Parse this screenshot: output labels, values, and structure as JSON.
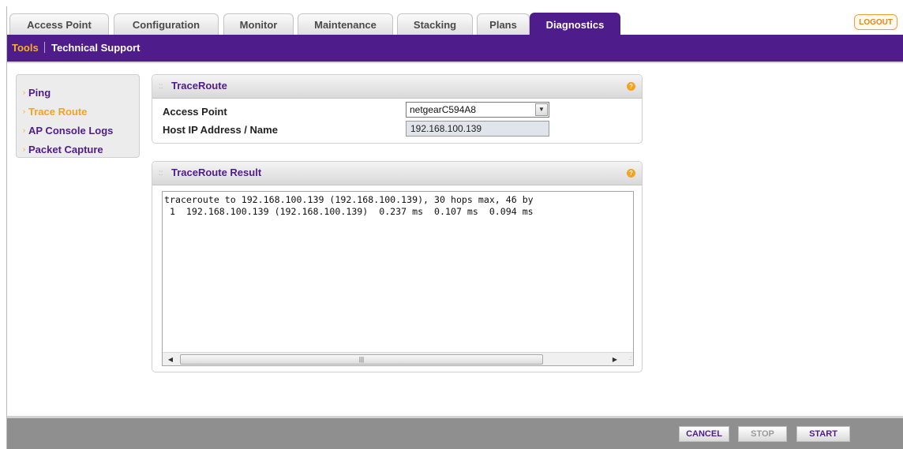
{
  "tabs": [
    {
      "label": "Access Point",
      "active": false
    },
    {
      "label": "Configuration",
      "active": false
    },
    {
      "label": "Monitor",
      "active": false
    },
    {
      "label": "Maintenance",
      "active": false
    },
    {
      "label": "Stacking",
      "active": false
    },
    {
      "label": "Plans",
      "active": false
    },
    {
      "label": "Diagnostics",
      "active": true
    }
  ],
  "logout_label": "LOGOUT",
  "subnav": {
    "items": [
      {
        "label": "Tools",
        "active": true
      },
      {
        "label": "Technical Support",
        "active": false
      }
    ]
  },
  "sidebar": {
    "items": [
      {
        "label": "Ping",
        "active": false
      },
      {
        "label": "Trace Route",
        "active": true
      },
      {
        "label": "AP Console Logs",
        "active": false
      },
      {
        "label": "Packet Capture",
        "active": false
      }
    ]
  },
  "traceroute": {
    "title": "TraceRoute",
    "access_point_label": "Access Point",
    "access_point_value": "netgearC594A8",
    "host_label": "Host IP Address / Name",
    "host_value": "192.168.100.139"
  },
  "result": {
    "title": "TraceRoute Result",
    "line1": "traceroute to 192.168.100.139 (192.168.100.139), 30 hops max, 46 by",
    "line2": " 1  192.168.100.139 (192.168.100.139)  0.237 ms  0.107 ms  0.094 ms"
  },
  "buttons": {
    "cancel": "CANCEL",
    "stop": "STOP",
    "start": "START"
  },
  "colors": {
    "brand_purple": "#4f1c8c",
    "accent_orange": "#f7a21c"
  }
}
